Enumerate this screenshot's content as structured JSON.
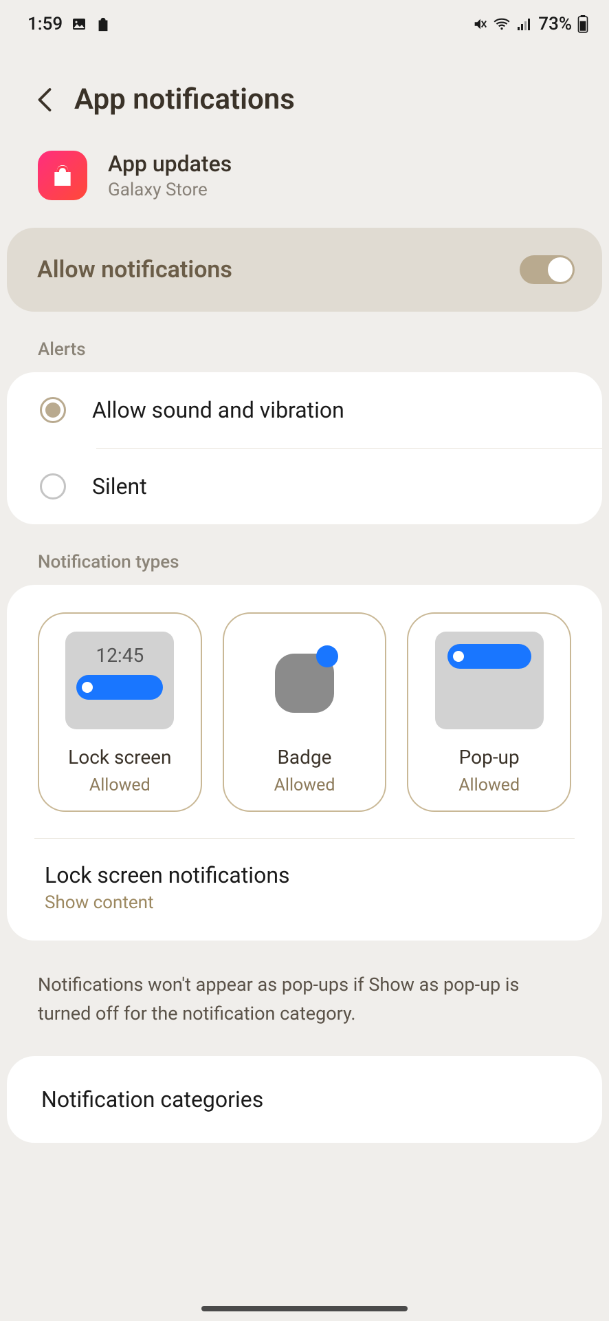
{
  "status": {
    "time": "1:59",
    "battery": "73%"
  },
  "header": {
    "title": "App notifications"
  },
  "app": {
    "name": "App updates",
    "source": "Galaxy Store"
  },
  "allow": {
    "label": "Allow notifications",
    "enabled": true
  },
  "alerts": {
    "section_label": "Alerts",
    "options": [
      {
        "label": "Allow sound and vibration",
        "selected": true
      },
      {
        "label": "Silent",
        "selected": false
      }
    ]
  },
  "types": {
    "section_label": "Notification types",
    "preview_time": "12:45",
    "items": [
      {
        "title": "Lock screen",
        "status": "Allowed"
      },
      {
        "title": "Badge",
        "status": "Allowed"
      },
      {
        "title": "Pop-up",
        "status": "Allowed"
      }
    ],
    "lock_screen": {
      "title": "Lock screen notifications",
      "subtitle": "Show content"
    }
  },
  "info": "Notifications won't appear as pop-ups if Show as pop-up is turned off for the notification category.",
  "categories": {
    "title": "Notification categories"
  }
}
